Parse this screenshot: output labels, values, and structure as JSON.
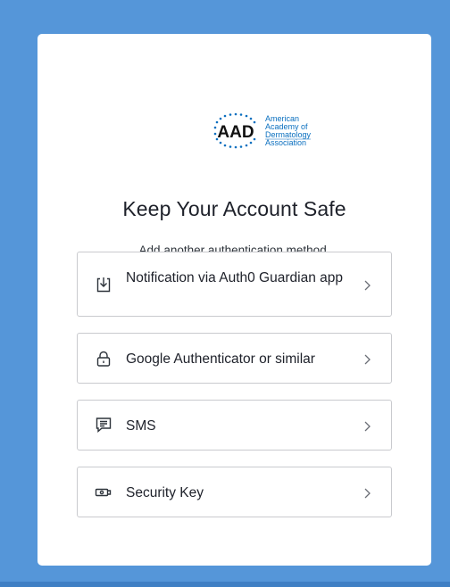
{
  "logo": {
    "mark": "AAD",
    "lines": [
      "American",
      "Academy of",
      "Dermatology",
      "Association"
    ],
    "color": "#0a6fbf"
  },
  "heading": "Keep Your Account Safe",
  "subheading": "Add another authentication method.",
  "options": [
    {
      "label": "Notification via Auth0 Guardian app",
      "icon": "download-icon"
    },
    {
      "label": "Google Authenticator or similar",
      "icon": "lock-icon"
    },
    {
      "label": "SMS",
      "icon": "sms-icon"
    },
    {
      "label": "Security Key",
      "icon": "security-key-icon"
    }
  ],
  "colors": {
    "page_background": "#5596d9",
    "card_background": "#ffffff",
    "border": "#c9cace",
    "text": "#1e212a"
  }
}
